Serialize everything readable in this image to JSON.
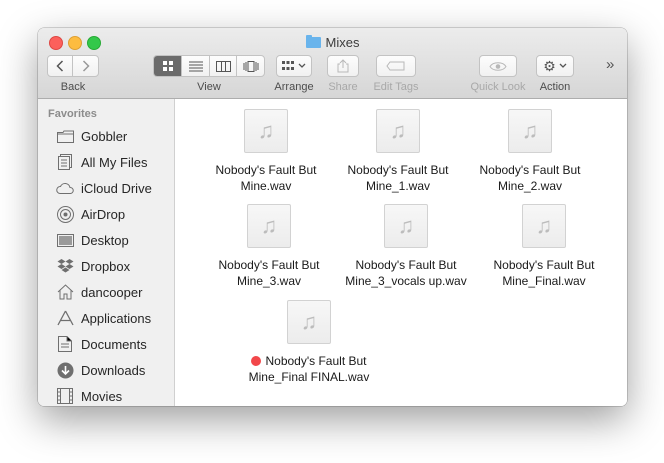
{
  "window": {
    "title": "Mixes"
  },
  "toolbar": {
    "back_label": "Back",
    "view_label": "View",
    "arrange_label": "Arrange",
    "share_label": "Share",
    "edit_tags_label": "Edit Tags",
    "quick_look_label": "Quick Look",
    "action_label": "Action",
    "overflow": "»"
  },
  "sidebar": {
    "heading": "Favorites",
    "items": [
      {
        "label": "Gobbler",
        "icon": "folder-icon"
      },
      {
        "label": "All My Files",
        "icon": "all-files-icon"
      },
      {
        "label": "iCloud Drive",
        "icon": "cloud-icon"
      },
      {
        "label": "AirDrop",
        "icon": "airdrop-icon"
      },
      {
        "label": "Desktop",
        "icon": "desktop-icon"
      },
      {
        "label": "Dropbox",
        "icon": "dropbox-icon"
      },
      {
        "label": "dancooper",
        "icon": "home-icon"
      },
      {
        "label": "Applications",
        "icon": "applications-icon"
      },
      {
        "label": "Documents",
        "icon": "documents-icon"
      },
      {
        "label": "Downloads",
        "icon": "downloads-icon"
      },
      {
        "label": "Movies",
        "icon": "movies-icon"
      }
    ]
  },
  "files": [
    {
      "line1": "Nobody's Fault But",
      "line2": "Mine.wav"
    },
    {
      "line1": "Nobody's Fault But",
      "line2": "Mine_1.wav"
    },
    {
      "line1": "Nobody's Fault But",
      "line2": "Mine_2.wav"
    },
    {
      "line1": "Nobody's Fault But",
      "line2": "Mine_3.wav"
    },
    {
      "line1": "Nobody's Fault But",
      "line2": "Mine_3_vocals up.wav"
    },
    {
      "line1": "Nobody's Fault But",
      "line2": "Mine_Final.wav"
    },
    {
      "line1": "Nobody's Fault But",
      "line2": "Mine_Final FINAL.wav",
      "tag_color": "#f2474a"
    }
  ],
  "colors": {
    "accent_tag_red": "#f2474a",
    "folder_blue": "#69b4ec"
  }
}
